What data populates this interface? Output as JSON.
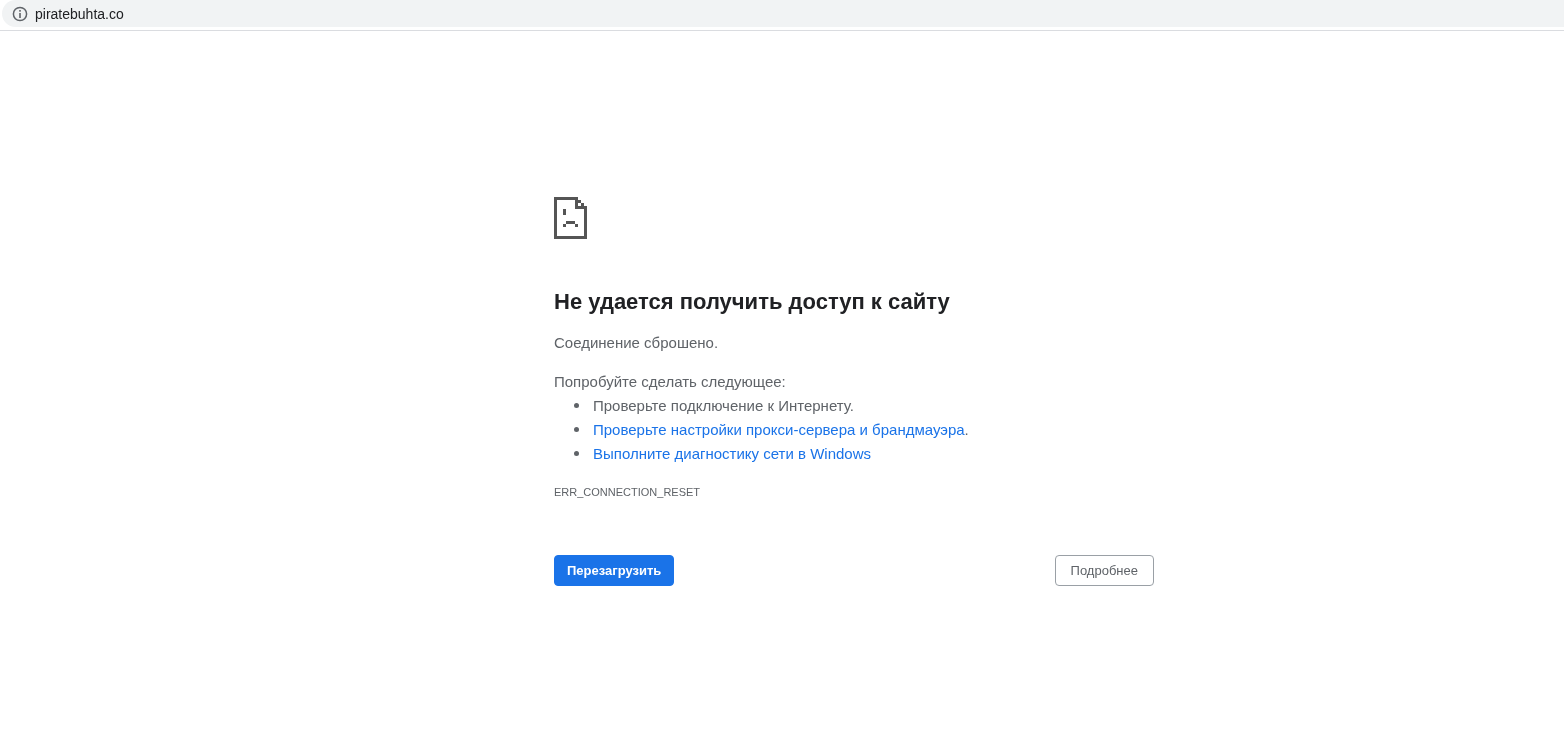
{
  "address_bar": {
    "url": "piratebuhta.co"
  },
  "error_page": {
    "title": "Не удается получить доступ к сайту",
    "message": "Соединение сброшено.",
    "suggestions_heading": "Попробуйте сделать следующее:",
    "suggestions": [
      {
        "kind": "text",
        "text": "Проверьте подключение к Интернету."
      },
      {
        "kind": "link",
        "text": "Проверьте настройки прокси-сервера и брандмауэра",
        "after": "."
      },
      {
        "kind": "link",
        "text": "Выполните диагностику сети в Windows"
      }
    ],
    "error_code": "ERR_CONNECTION_RESET"
  },
  "buttons": [
    {
      "kind": "primary",
      "label": "Перезагрузить"
    },
    {
      "kind": "secondary",
      "label": "Подробнее"
    }
  ]
}
